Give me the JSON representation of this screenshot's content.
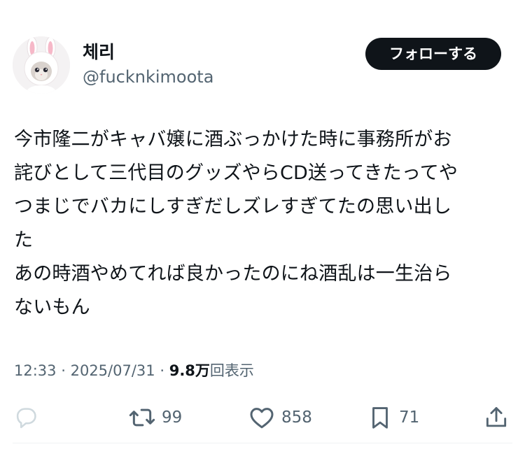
{
  "author": {
    "display_name": "체리",
    "handle": "@fucknkimoota"
  },
  "follow_button": {
    "label": "フォローする"
  },
  "tweet": {
    "lines": [
      "今市隆二がキャバ嬢に酒ぶっかけた時に事務所がお",
      "詫びとして三代目のグッズやらCD送ってきたってや",
      "つまじでバカにしすぎだしズレすぎてたの思い出し",
      "た",
      "あの時酒やめてれば良かったのにね酒乱は一生治ら",
      "ないもん"
    ]
  },
  "meta": {
    "time": "12:33",
    "separator": "·",
    "date": "2025/07/31",
    "views_count": "9.8万",
    "views_label": "回表示"
  },
  "actions": {
    "reply": {
      "icon": "reply-icon",
      "count": ""
    },
    "retweet": {
      "icon": "retweet-icon",
      "count": "99"
    },
    "like": {
      "icon": "heart-icon",
      "count": "858"
    },
    "bookmark": {
      "icon": "bookmark-icon",
      "count": "71"
    },
    "share": {
      "icon": "share-icon"
    }
  },
  "colors": {
    "text_primary": "#0f1419",
    "text_secondary": "#536471",
    "button_bg": "#0f1419",
    "button_text": "#ffffff",
    "icon_muted": "#cfd9de",
    "divider": "#eff3f4"
  }
}
